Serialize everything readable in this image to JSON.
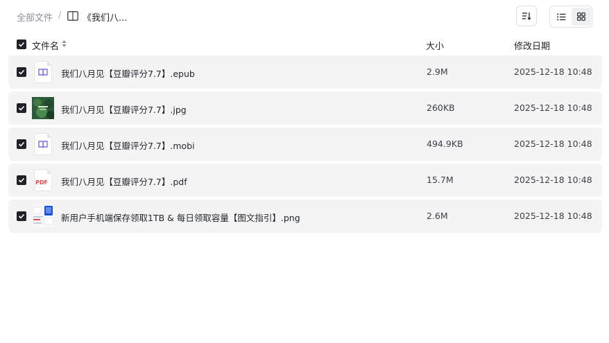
{
  "breadcrumb": {
    "root": "全部文件",
    "separator": "/",
    "current": "《我们八..."
  },
  "toolbar": {
    "sort_icon": "sort-icon",
    "list_view_icon": "list-icon",
    "grid_view_icon": "grid-icon"
  },
  "columns": {
    "name": "文件名",
    "size": "大小",
    "modified": "修改日期"
  },
  "files": [
    {
      "name": "我们八月见【豆瓣评分7.7】.epub",
      "size": "2.9M",
      "modified": "2025-12-18 10:48",
      "type": "ebook"
    },
    {
      "name": "我们八月见【豆瓣评分7.7】.jpg",
      "size": "260KB",
      "modified": "2025-12-18 10:48",
      "type": "image"
    },
    {
      "name": "我们八月见【豆瓣评分7.7】.mobi",
      "size": "494.9KB",
      "modified": "2025-12-18 10:48",
      "type": "ebook"
    },
    {
      "name": "我们八月见【豆瓣评分7.7】.pdf",
      "size": "15.7M",
      "modified": "2025-12-18 10:48",
      "type": "pdf"
    },
    {
      "name": "新用户手机端保存领取1TB & 每日领取容量【图文指引】.png",
      "size": "2.6M",
      "modified": "2025-12-18 10:48",
      "type": "image"
    }
  ],
  "pdf_badge": "PDF",
  "colors": {
    "ebook_icon": "#7b6cf6",
    "pdf_icon": "#e5484d",
    "row_bg": "#f4f4f5",
    "checkbox": "#1f2329"
  }
}
